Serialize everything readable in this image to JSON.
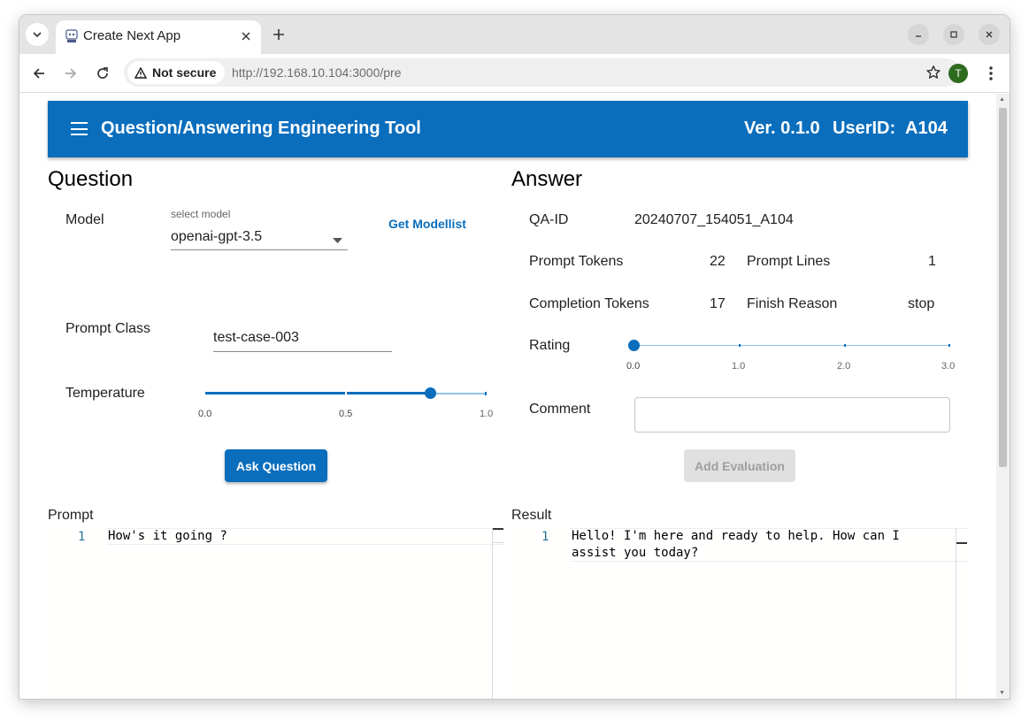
{
  "browser": {
    "tab_title": "Create Next App",
    "security_label": "Not secure",
    "url_host": "http://192.168.10.104",
    "url_path": ":3000/pre",
    "profile_initial": "T"
  },
  "appbar": {
    "title": "Question/Answering Engineering Tool",
    "version": "Ver. 0.1.0",
    "user_label": "UserID:",
    "user_id": "A104"
  },
  "question": {
    "heading": "Question",
    "model_label": "Model",
    "model_select_label": "select model",
    "model_value": "openai-gpt-3.5",
    "get_modellist": "Get Modellist",
    "prompt_class_label": "Prompt Class",
    "prompt_class_value": "test-case-003",
    "temperature_label": "Temperature",
    "temperature_value": 0.8,
    "temperature_ticks": [
      "0.0",
      "0.5",
      "1.0"
    ],
    "ask_button": "Ask Question"
  },
  "answer": {
    "heading": "Answer",
    "qa_id_label": "QA-ID",
    "qa_id_value": "20240707_154051_A104",
    "prompt_tokens_label": "Prompt Tokens",
    "prompt_tokens_value": "22",
    "prompt_lines_label": "Prompt Lines",
    "prompt_lines_value": "1",
    "completion_tokens_label": "Completion Tokens",
    "completion_tokens_value": "17",
    "finish_reason_label": "Finish Reason",
    "finish_reason_value": "stop",
    "rating_label": "Rating",
    "rating_value": 0,
    "rating_ticks": [
      "0.0",
      "1.0",
      "2.0",
      "3.0"
    ],
    "comment_label": "Comment",
    "comment_value": "",
    "add_eval_button": "Add Evaluation"
  },
  "prompt_editor": {
    "label": "Prompt",
    "line_number": "1",
    "code": "How's it going ?"
  },
  "result_editor": {
    "label": "Result",
    "line_number": "1",
    "line1": "Hello! I'm here and ready to help. How can I",
    "line2": "assist you today?"
  },
  "colors": {
    "primary": "#0a6ebd",
    "slider_track": "#90c2e8"
  }
}
